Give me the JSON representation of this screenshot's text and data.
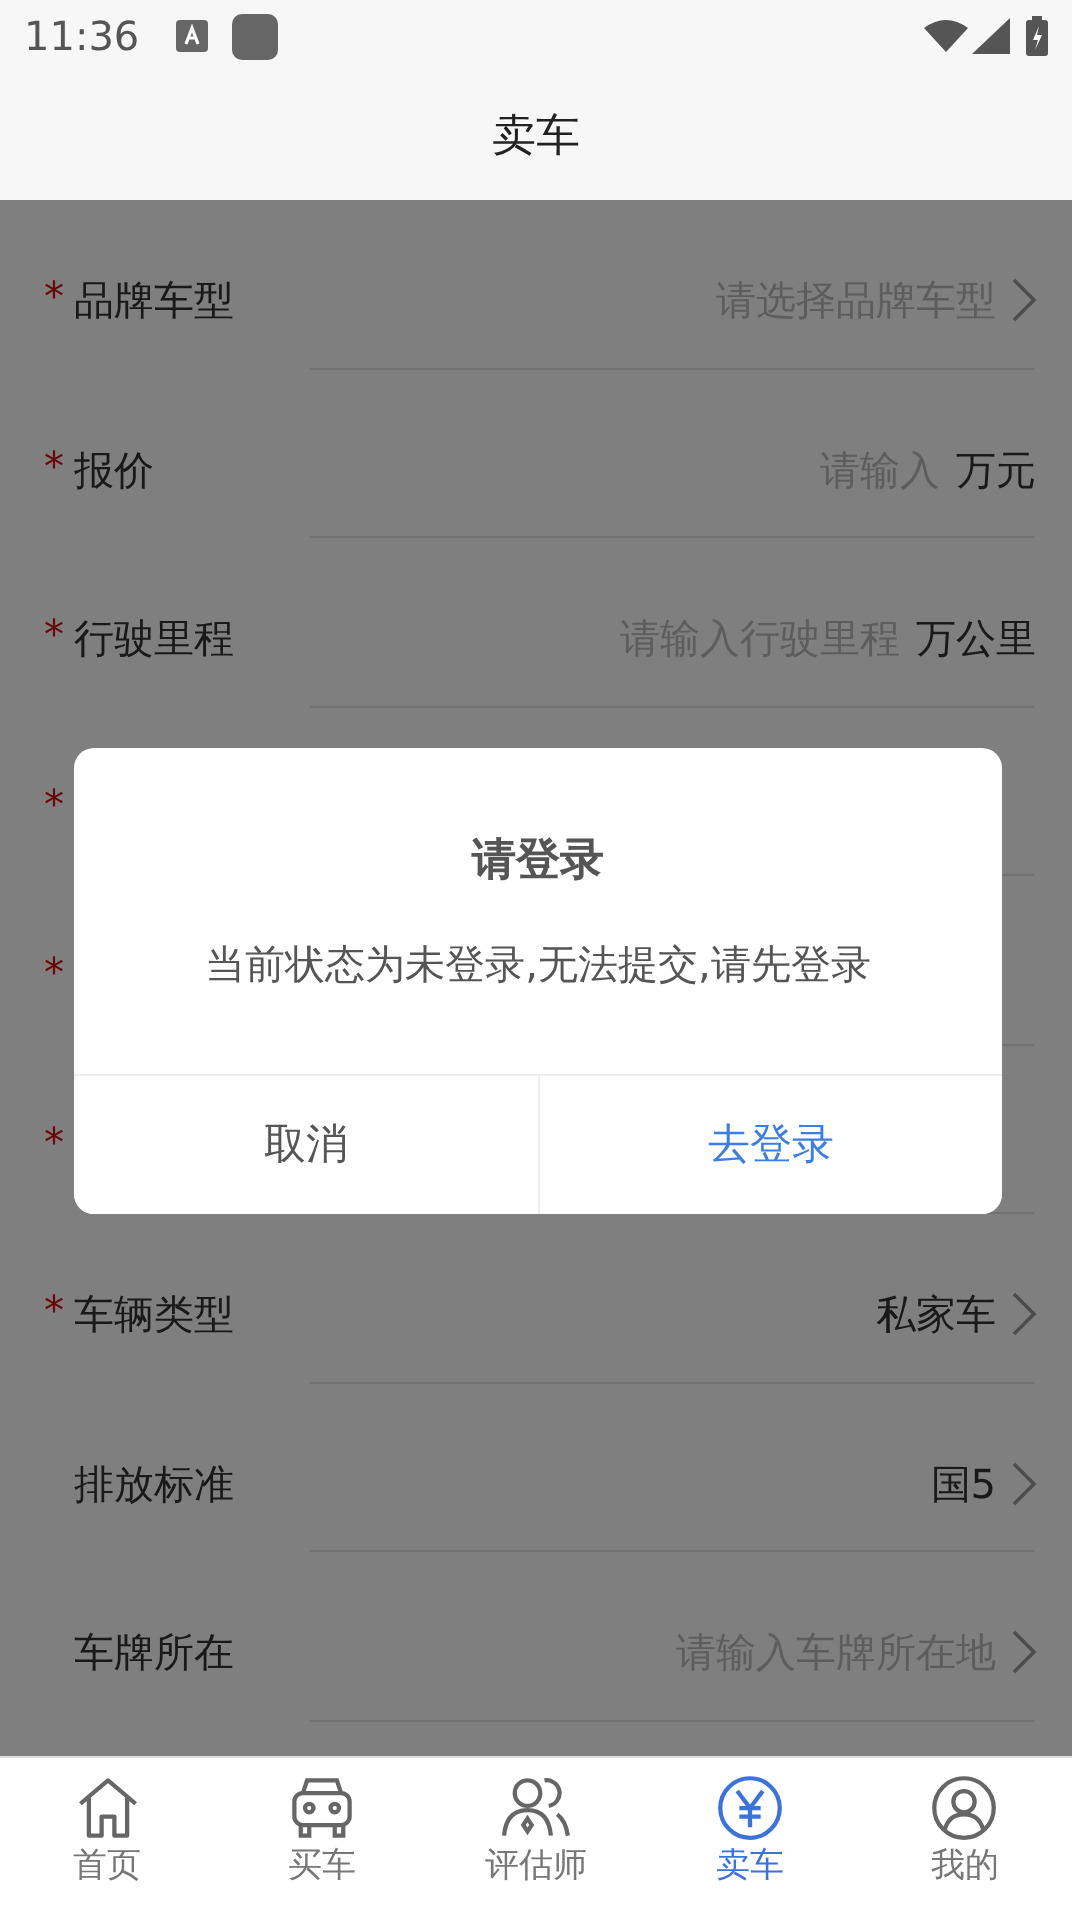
{
  "status_bar": {
    "time": "11:36"
  },
  "header": {
    "title": "卖车"
  },
  "form_rows": [
    {
      "required_mark": "*",
      "label": "品牌车型",
      "kind": "select",
      "placeholder": "请选择品牌车型"
    },
    {
      "required_mark": "*",
      "label": "报价",
      "kind": "input",
      "placeholder": "请输入",
      "unit": "万元"
    },
    {
      "required_mark": "*",
      "label": "行驶里程",
      "kind": "input",
      "placeholder": "请输入行驶里程",
      "unit": "万公里"
    },
    {
      "required_mark": "*",
      "kind": "hidden"
    },
    {
      "required_mark": "*",
      "kind": "hidden"
    },
    {
      "required_mark": "*",
      "kind": "hidden"
    },
    {
      "required_mark": "*",
      "label": "车辆类型",
      "kind": "select",
      "value": "私家车"
    },
    {
      "label": "排放标准",
      "kind": "select",
      "value": "国5"
    },
    {
      "label": "车牌所在",
      "kind": "select",
      "placeholder": "请输入车牌所在地"
    }
  ],
  "dialog": {
    "title": "请登录",
    "message": "当前状态为未登录,无法提交,请先登录",
    "buttons": [
      {
        "label": "取消",
        "kind": "cancel"
      },
      {
        "label": "去登录",
        "kind": "confirm"
      }
    ]
  },
  "bottom_nav": [
    {
      "label": "首页",
      "selected": false
    },
    {
      "label": "买车",
      "selected": false
    },
    {
      "label": "评估师",
      "selected": false
    },
    {
      "label": "卖车",
      "selected": true
    },
    {
      "label": "我的",
      "selected": false
    }
  ]
}
